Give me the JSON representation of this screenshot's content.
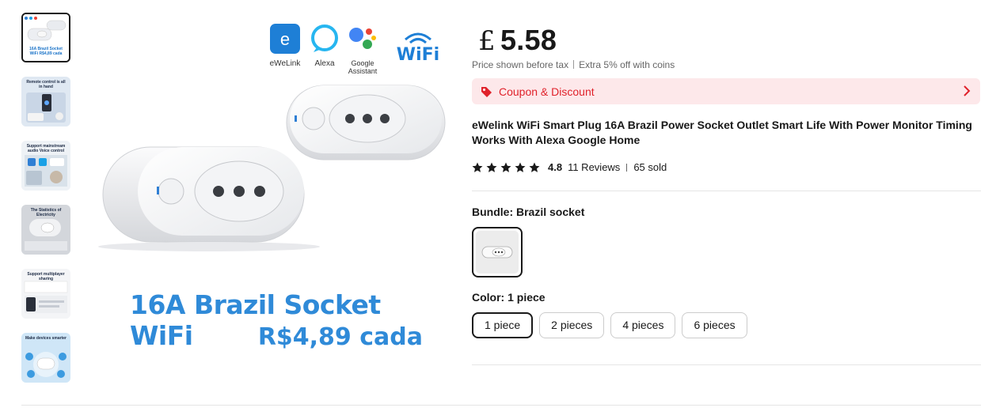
{
  "gallery": {
    "thumbnails": [
      {
        "caption": "",
        "subcaption": "16A Brazil Socket WiFi R$4,89 cada",
        "name": "thumb-1"
      },
      {
        "caption": "Remote control is all in hand",
        "subcaption": "",
        "name": "thumb-2"
      },
      {
        "caption": "Support mainstream audio Voice control",
        "subcaption": "",
        "name": "thumb-3"
      },
      {
        "caption": "The Statistics of Electricity",
        "subcaption": "",
        "name": "thumb-4"
      },
      {
        "caption": "Support multiplayer sharing",
        "subcaption": "",
        "name": "thumb-5"
      },
      {
        "caption": "Make devices smarter",
        "subcaption": "",
        "name": "thumb-6"
      }
    ],
    "main": {
      "logos": [
        "eWeLink",
        "Alexa",
        "Google Assistant",
        "WiFi"
      ],
      "logo_ewelink_letter": "e",
      "headline": "16A Brazil Socket WiFi",
      "price_line": "R$4,89 cada"
    }
  },
  "product": {
    "currency": "£",
    "price": "5.58",
    "price_note": "Price shown before tax",
    "coins_note": "Extra 5% off with coins",
    "coupon_label": "Coupon & Discount",
    "title": "eWelink WiFi Smart Plug 16A Brazil Power Socket Outlet Smart Life With Power Monitor Timing Works With Alexa Google Home",
    "rating": "4.8",
    "stars": 5,
    "reviews": "11 Reviews",
    "sold": "65 sold",
    "bundle_label": "Bundle: Brazil socket",
    "color_label": "Color: 1 piece",
    "color_options": [
      "1 piece",
      "2 pieces",
      "4 pieces",
      "6 pieces"
    ],
    "selected_color": "1 piece"
  },
  "colors": {
    "accent_red": "#e0222b",
    "coupon_bg": "#fde8ea",
    "hero_blue": "#2f8ad8"
  },
  "icons": [
    "coupon-tag-icon",
    "chevron-right-icon",
    "star-icon"
  ]
}
